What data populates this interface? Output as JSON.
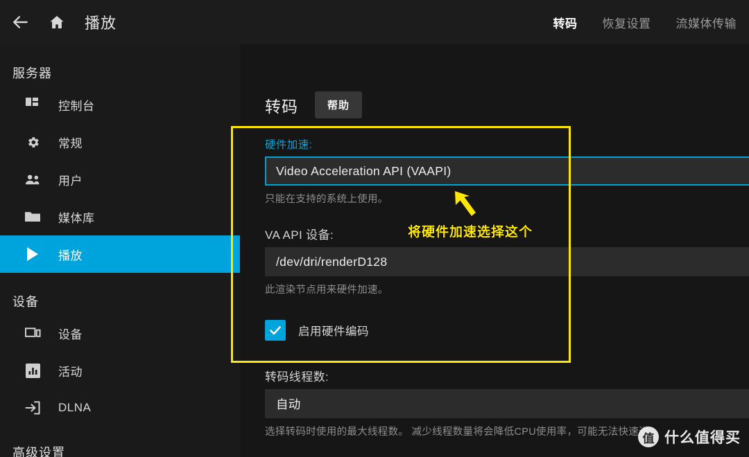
{
  "header": {
    "back_icon": "arrow-left-icon",
    "home_icon": "home-icon",
    "title": "播放",
    "tabs": [
      {
        "label": "转码",
        "active": true
      },
      {
        "label": "恢复设置",
        "active": false
      },
      {
        "label": "流媒体传输",
        "active": false
      }
    ]
  },
  "sidebar": {
    "sections": [
      {
        "title": "服务器",
        "items": [
          {
            "label": "控制台",
            "icon": "dashboard-icon",
            "active": false
          },
          {
            "label": "常规",
            "icon": "gear-icon",
            "active": false
          },
          {
            "label": "用户",
            "icon": "people-icon",
            "active": false
          },
          {
            "label": "媒体库",
            "icon": "folder-icon",
            "active": false
          },
          {
            "label": "播放",
            "icon": "play-icon",
            "active": true
          }
        ]
      },
      {
        "title": "设备",
        "items": [
          {
            "label": "设备",
            "icon": "devices-icon",
            "active": false
          },
          {
            "label": "活动",
            "icon": "bar-chart-icon",
            "active": false
          },
          {
            "label": "DLNA",
            "icon": "cast-in-icon",
            "active": false
          }
        ]
      }
    ],
    "cut_off_section_title": "高级设置"
  },
  "main": {
    "page_title": "转码",
    "help_button": "帮助",
    "fields": [
      {
        "label": "硬件加速:",
        "value": "Video Acceleration API (VAAPI)",
        "help": "只能在支持的系统上使用。",
        "type": "select",
        "focused": true,
        "label_accent": true
      },
      {
        "label": "VA API 设备:",
        "value": "/dev/dri/renderD128",
        "help": "此渲染节点用来硬件加速。",
        "type": "text",
        "focused": false,
        "label_accent": false
      }
    ],
    "checkbox": {
      "label": "启用硬件编码",
      "checked": true,
      "icon": "check-icon"
    },
    "threads_field": {
      "label": "转码线程数:",
      "value": "自动",
      "help": "选择转码时使用的最大线程数。 减少线程数量将会降低CPU使用率，可能无法快速进"
    }
  },
  "annotation": {
    "text": "将硬件加速选择这个",
    "arrow_icon": "arrow-up-left-icon",
    "box_color": "#ffe800",
    "text_color": "#ffe800"
  },
  "watermark": {
    "logo_glyph": "值",
    "text": "什么值得买"
  },
  "colors": {
    "accent": "#00a4dc",
    "annotation": "#ffe800",
    "page_bg": "#161616",
    "sidebar_bg": "#1a1a1a",
    "header_bg": "#1c1c1c",
    "input_bg": "#2c2c2c"
  }
}
